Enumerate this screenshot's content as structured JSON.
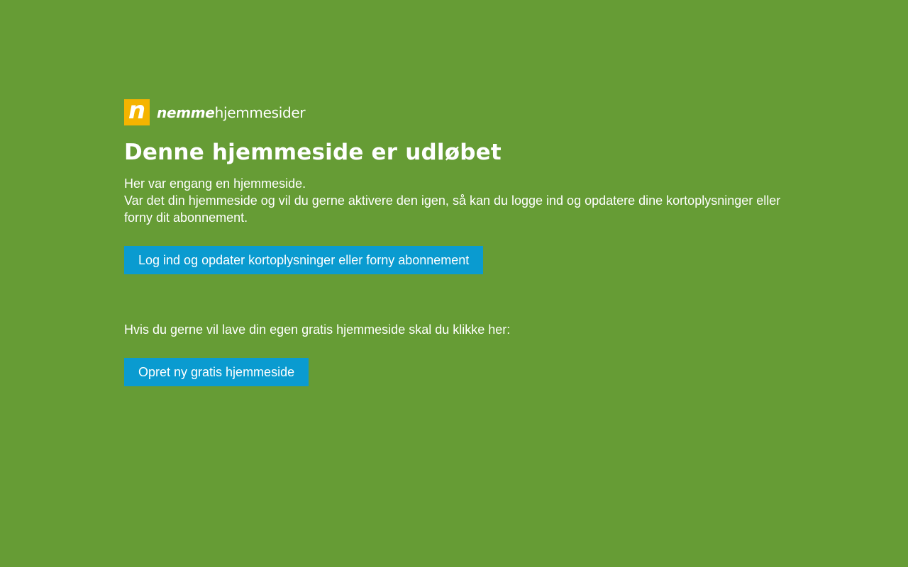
{
  "logo": {
    "mark": "n",
    "brand_strong": "nemme",
    "brand_light": "hjemmesider"
  },
  "page": {
    "title": "Denne hjemmeside er udløbet",
    "intro_line1": "Her var engang en hjemmeside.",
    "intro_line2": "Var det din hjemmeside og vil du gerne aktivere den igen, så kan du logge ind og opdatere dine kortoplysninger eller forny dit abonnement.",
    "login_button": "Log ind og opdater kortoplysninger eller forny abonnement",
    "cta_text": "Hvis du gerne vil lave din egen gratis hjemmeside skal du klikke her:",
    "create_button": "Opret ny gratis hjemmeside"
  },
  "colors": {
    "background": "#669c35",
    "logo_mark": "#f5b400",
    "button": "#0a9bd0",
    "text": "#ffffff"
  }
}
